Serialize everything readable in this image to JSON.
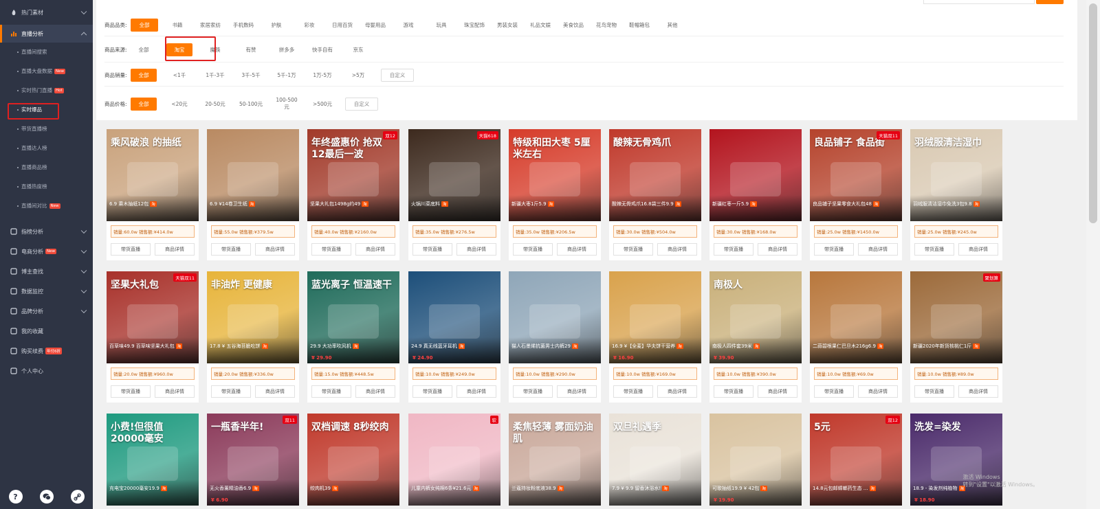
{
  "sidebar": {
    "top_item": "热门素材",
    "active_group": "直播分析",
    "sub_items": [
      {
        "label": "直播间搜索",
        "badge": ""
      },
      {
        "label": "直播大盘数据",
        "badge": "New"
      },
      {
        "label": "实时热门直播",
        "badge": "Hot"
      },
      {
        "label": "实时爆品",
        "badge": ""
      },
      {
        "label": "带货直播榜",
        "badge": ""
      },
      {
        "label": "直播达人榜",
        "badge": ""
      },
      {
        "label": "直播商品榜",
        "badge": ""
      },
      {
        "label": "直播热度榜",
        "badge": ""
      },
      {
        "label": "直播间对比",
        "badge": "New"
      }
    ],
    "groups": [
      {
        "label": "指榜分析",
        "badge": "",
        "icon": "chart-icon"
      },
      {
        "label": "电商分析",
        "badge": "New",
        "icon": "shop-icon"
      },
      {
        "label": "博主查找",
        "badge": "",
        "icon": "search-icon"
      },
      {
        "label": "数据监控",
        "badge": "",
        "icon": "monitor-icon"
      },
      {
        "label": "品牌分析",
        "badge": "",
        "icon": "brand-icon"
      },
      {
        "label": "我的收藏",
        "badge": "",
        "icon": "star-icon"
      },
      {
        "label": "购买续费",
        "badge": "年付6折",
        "icon": "cart-icon"
      },
      {
        "label": "个人中心",
        "badge": "",
        "icon": "user-icon"
      }
    ],
    "bottom_icons": [
      "help-icon",
      "wechat-icon",
      "link-icon"
    ]
  },
  "filters": {
    "category": {
      "label": "商品品类:",
      "options": [
        "全部",
        "书籍",
        "家居家纺",
        "手机数码",
        "护肤",
        "彩妆",
        "日用百货",
        "母婴用品",
        "游戏",
        "玩具",
        "珠宝配饰",
        "男装女装",
        "礼品文娱",
        "美食饮品",
        "花鸟宠物",
        "鞋帽箱包",
        "其他"
      ]
    },
    "source": {
      "label": "商品来源:",
      "options": [
        "全部",
        "淘宝",
        "魔筷",
        "有赞",
        "拼多多",
        "快手自有",
        "京东"
      ]
    },
    "sales": {
      "label": "商品销量:",
      "options": [
        "全部",
        "<1千",
        "1千-3千",
        "3千-5千",
        "5千-1万",
        "1万-5万",
        ">5万"
      ],
      "custom": "自定义"
    },
    "price": {
      "label": "商品价格:",
      "options": [
        "全部",
        "<20元",
        "20-50元",
        "50-100元",
        "100-500元",
        ">500元"
      ],
      "custom": "自定义"
    }
  },
  "labels": {
    "live_btn": "带货直播",
    "detail_btn": "商品详情",
    "tb_badge": "淘"
  },
  "products": [
    {
      "title": "6.9 乘木抽纸12包",
      "stats": "销量:60.0w  销售额:¥414.0w",
      "big": "乘风破浪 的抽纸",
      "tag": "",
      "price": "",
      "bg": "#c9a27c"
    },
    {
      "title": "6.9 ¥14卷卫生纸",
      "stats": "销量:55.0w  销售额:¥379.5w",
      "big": "",
      "tag": "",
      "price": "",
      "bg": "#b98a62"
    },
    {
      "title": "坚果大礼包1498g约49",
      "stats": "销量:40.0w  销售额:¥2160.0w",
      "big": "年终盛惠价 抢双12最后一波",
      "tag": "双12",
      "price": "",
      "bg": "#a23a2a"
    },
    {
      "title": "火锅川菜底料",
      "stats": "销量:35.0w  销售额:¥276.5w",
      "big": "",
      "tag": "天猫618",
      "price": "",
      "bg": "#3d2a1e"
    },
    {
      "title": "新疆大枣1斤5.9",
      "stats": "销量:35.0w  销售额:¥206.5w",
      "big": "特级和田大枣 5厘米左右",
      "tag": "",
      "price": "",
      "bg": "#d63c2a"
    },
    {
      "title": "酸辣无骨鸡爪16.8袋三件9.9",
      "stats": "销量:30.0w  销售额:¥504.0w",
      "big": "酸辣无骨鸡爪",
      "tag": "",
      "price": "",
      "bg": "#c0392b"
    },
    {
      "title": "新疆红枣一斤5.9",
      "stats": "销量:30.0w  销售额:¥168.0w",
      "big": "",
      "tag": "",
      "price": "",
      "bg": "#b3141e"
    },
    {
      "title": "良品铺子坚果零食大礼包48",
      "stats": "销量:25.0w  销售额:¥1450.0w",
      "big": "良品铺子 食品街",
      "tag": "天猫双11",
      "price": "",
      "bg": "#b5432c"
    },
    {
      "title": "羽绒服清洁湿巾免洗3包9.8",
      "stats": "销量:25.0w  销售额:¥245.0w",
      "big": "羽绒服清洁湿巾",
      "tag": "",
      "price": "",
      "bg": "#d9c9b2"
    },
    {
      "title": "百草味49.9 百草味坚果大礼包",
      "stats": "销量:20.0w  销售额:¥960.0w",
      "big": "坚果大礼包",
      "tag": "天猫双11",
      "price": "",
      "bg": "#a8312a"
    },
    {
      "title": "17.8 ¥ 五谷海苔脆吃饼",
      "stats": "销量:20.0w  销售额:¥336.0w",
      "big": "非油炸 更健康",
      "tag": "",
      "price": "",
      "bg": "#e7b43a"
    },
    {
      "title": "29.9 大功率吹风机",
      "stats": "销量:15.0w  销售额:¥448.5w",
      "big": "蓝光离子 恒温速干",
      "tag": "",
      "price": "¥ 29.90",
      "bg": "#1f6b5a"
    },
    {
      "title": "24.9 真无线蓝牙耳机",
      "stats": "销量:10.0w  销售额:¥249.0w",
      "big": "",
      "tag": "",
      "price": "¥ 24.90",
      "bg": "#1d4f7a"
    },
    {
      "title": "猫人石墨烯抗菌男士内裤29",
      "stats": "销量:10.0w  销售额:¥290.0w",
      "big": "",
      "tag": "",
      "price": "",
      "bg": "#8fa6b8"
    },
    {
      "title": "16.9 ¥【全麦】华夫饼干营养",
      "stats": "销量:10.0w  销售额:¥169.0w",
      "big": "",
      "tag": "",
      "price": "¥ 16.90",
      "bg": "#d9a24c"
    },
    {
      "title": "南极人四件套39米",
      "stats": "销量:10.0w  销售额:¥390.0w",
      "big": "南极人",
      "tag": "",
      "price": "¥ 39.90",
      "bg": "#c9b07a"
    },
    {
      "title": "二蒜碧根果仁巴旦木216g6.9",
      "stats": "销量:10.0w  销售额:¥69.0w",
      "big": "",
      "tag": "",
      "price": "",
      "bg": "#b8773c"
    },
    {
      "title": "新疆2020年新货核桃仁1斤",
      "stats": "销量:10.0w  销售额:¥89.0w",
      "big": "",
      "tag": "聚划算",
      "price": "",
      "bg": "#9c6a3a"
    },
    {
      "title": "充电宝20000毫安19.9",
      "stats": "",
      "big": "小费!但很值 20000毫安",
      "tag": "",
      "price": "",
      "bg": "#1e9a7f"
    },
    {
      "title": "无火香薰精油香6.9",
      "stats": "",
      "big": "一瓶香半年!",
      "tag": "双11",
      "price": "¥ 6.90",
      "bg": "#8b3a5a"
    },
    {
      "title": "绞肉机39",
      "stats": "",
      "big": "双档调速 8秒绞肉",
      "tag": "",
      "price": "",
      "bg": "#c0392b"
    },
    {
      "title": "儿童内裤女纯棉6条¥21.6元",
      "stats": "",
      "big": "",
      "tag": "软",
      "price": "",
      "bg": "#f0b7c4"
    },
    {
      "title": "兰蔻持妆粉底液38.9",
      "stats": "",
      "big": "柔焦轻薄 雾面奶油肌",
      "tag": "",
      "price": "",
      "bg": "#c9a89a"
    },
    {
      "title": "7.9 ¥ 9.9 留香沐浴水!",
      "stats": "",
      "big": "双旦礼遇季",
      "tag": "",
      "price": "",
      "bg": "#e9e2d8"
    },
    {
      "title": "可歌抽纸19.9 ¥ 42包",
      "stats": "",
      "big": "",
      "tag": "",
      "price": "¥ 19.90",
      "bg": "#d9c3a0"
    },
    {
      "title": "14.8元包邮蟑螂药生态 ...",
      "stats": "",
      "big": "5元",
      "tag": "双12",
      "price": "",
      "bg": "#c0392b"
    },
    {
      "title": "18.9 - 染发剂纯植物",
      "stats": "",
      "big": "洗发=染发",
      "tag": "",
      "price": "¥ 18.90",
      "bg": "#4a2a6a"
    }
  ],
  "watermark": {
    "line1": "激活 Windows",
    "line2": "转到\"设置\"以激活 Windows。"
  }
}
